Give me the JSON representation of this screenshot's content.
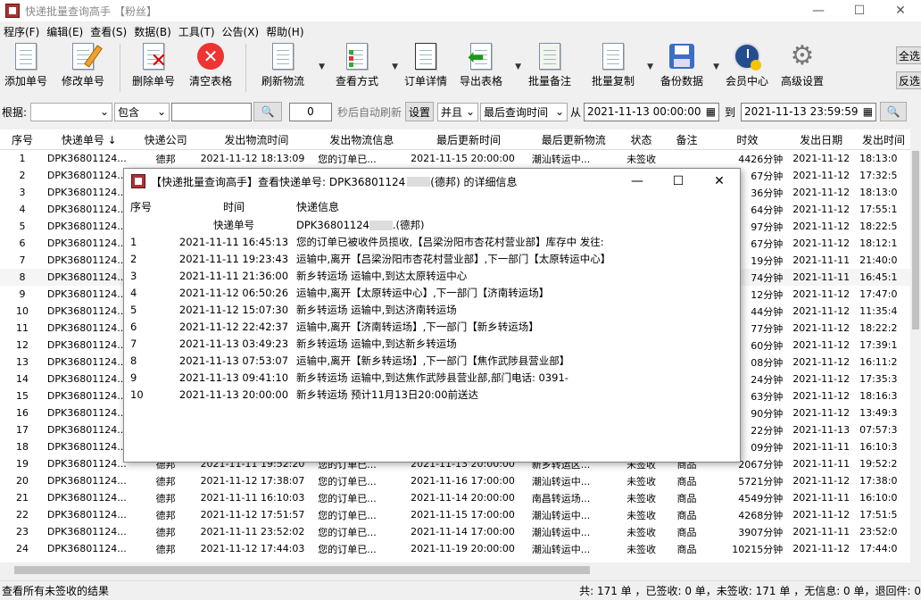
{
  "window": {
    "title": "快递批量查询高手",
    "title_suffix": "【粉丝】"
  },
  "menu": [
    "程序(F)",
    "编辑(E)",
    "查看(S)",
    "数据(B)",
    "工具(T)",
    "公告(X)",
    "帮助(H)"
  ],
  "toolbar": {
    "add": "添加单号",
    "edit": "修改单号",
    "delete": "删除单号",
    "clear": "清空表格",
    "refresh": "刷新物流",
    "view": "查看方式",
    "detail": "订单详情",
    "export": "导出表格",
    "note": "批量备注",
    "copy": "批量复制",
    "backup": "备份数据",
    "member": "会员中心",
    "advanced": "高级设置",
    "select_all": "全选",
    "invert": "反选"
  },
  "filter": {
    "label": "根据:",
    "field": "",
    "match": "包含",
    "keyword": "",
    "seconds": "0",
    "auto_refresh": "秒后自动刷新",
    "set": "设置",
    "and_or": "并且",
    "time_field": "最后查询时间",
    "from_label": "从",
    "from": "2021-11-13 00:00:00",
    "to_label": "到",
    "to": "2021-11-13 23:59:59"
  },
  "columns": [
    "序号",
    "快递单号 ↓",
    "快递公司",
    "发出物流时间",
    "发出物流信息",
    "最后更新时间",
    "最后更新物流",
    "状态",
    "备注",
    "时效",
    "发出日期",
    "发出时间"
  ],
  "rows": [
    [
      "1",
      "DPK36801124...",
      "德邦",
      "2021-11-12 18:13:09",
      "您的订单已...",
      "2021-11-15 20:00:00",
      "潮汕转运中...",
      "未签收",
      "",
      "4426分钟",
      "2021-11-12",
      "18:13:0"
    ],
    [
      "2",
      "DPK36801124...",
      "德邦",
      "",
      "",
      "",
      "",
      "",
      "",
      "67分钟",
      "2021-11-12",
      "17:32:5"
    ],
    [
      "3",
      "DPK36801124...",
      "德邦",
      "",
      "",
      "",
      "",
      "",
      "",
      "36分钟",
      "2021-11-12",
      "18:13:0"
    ],
    [
      "4",
      "DPK36801124...",
      "德邦",
      "",
      "",
      "",
      "",
      "",
      "",
      "64分钟",
      "2021-11-12",
      "17:55:1"
    ],
    [
      "5",
      "DPK36801124...",
      "德邦",
      "",
      "",
      "",
      "",
      "",
      "",
      "97分钟",
      "2021-11-12",
      "18:22:5"
    ],
    [
      "6",
      "DPK36801124...",
      "德邦",
      "",
      "",
      "",
      "",
      "",
      "",
      "67分钟",
      "2021-11-12",
      "18:12:1"
    ],
    [
      "7",
      "DPK36801124...",
      "德邦",
      "",
      "",
      "",
      "",
      "",
      "",
      "19分钟",
      "2021-11-11",
      "21:40:0"
    ],
    [
      "8",
      "DPK36801124...",
      "德邦",
      "",
      "",
      "",
      "",
      "",
      "",
      "74分钟",
      "2021-11-11",
      "16:45:1"
    ],
    [
      "9",
      "DPK36801124...",
      "德邦",
      "",
      "",
      "",
      "",
      "",
      "",
      "12分钟",
      "2021-11-12",
      "17:47:0"
    ],
    [
      "10",
      "DPK36801124...",
      "德邦",
      "",
      "",
      "",
      "",
      "",
      "",
      "44分钟",
      "2021-11-12",
      "11:35:4"
    ],
    [
      "11",
      "DPK36801124...",
      "德邦",
      "",
      "",
      "",
      "",
      "",
      "",
      "77分钟",
      "2021-11-12",
      "18:22:2"
    ],
    [
      "12",
      "DPK36801124...",
      "德邦",
      "",
      "",
      "",
      "",
      "",
      "",
      "60分钟",
      "2021-11-12",
      "17:39:1"
    ],
    [
      "13",
      "DPK36801124...",
      "德邦",
      "",
      "",
      "",
      "",
      "",
      "",
      "08分钟",
      "2021-11-12",
      "16:11:2"
    ],
    [
      "14",
      "DPK36801124...",
      "德邦",
      "",
      "",
      "",
      "",
      "",
      "",
      "24分钟",
      "2021-11-12",
      "17:35:3"
    ],
    [
      "15",
      "DPK36801124...",
      "德邦",
      "",
      "",
      "",
      "",
      "",
      "",
      "63分钟",
      "2021-11-12",
      "18:16:3"
    ],
    [
      "16",
      "DPK36801124...",
      "德邦",
      "",
      "",
      "",
      "",
      "",
      "",
      "90分钟",
      "2021-11-12",
      "13:49:3"
    ],
    [
      "17",
      "DPK36801124...",
      "德邦",
      "",
      "",
      "",
      "",
      "",
      "",
      "22分钟",
      "2021-11-13",
      "07:57:3"
    ],
    [
      "18",
      "DPK36801124...",
      "德邦",
      "",
      "",
      "",
      "",
      "",
      "",
      "09分钟",
      "2021-11-11",
      "16:10:3"
    ],
    [
      "19",
      "DPK36801124...",
      "德邦",
      "2021-11-11 19:52:20",
      "您的订单已...",
      "2021-11-13 20:00:00",
      "新乡转运区...",
      "未签收",
      "商品",
      "2067分钟",
      "2021-11-11",
      "19:52:2"
    ],
    [
      "20",
      "DPK36801124...",
      "德邦",
      "2021-11-12 17:38:07",
      "您的订单已...",
      "2021-11-16 17:00:00",
      "潮汕转运中...",
      "未签收",
      "商品",
      "5721分钟",
      "2021-11-12",
      "17:38:0"
    ],
    [
      "21",
      "DPK36801124...",
      "德邦",
      "2021-11-11 16:10:03",
      "您的订单已...",
      "2021-11-14 20:00:00",
      "南昌转运场...",
      "未签收",
      "商品",
      "4549分钟",
      "2021-11-11",
      "16:10:0"
    ],
    [
      "22",
      "DPK36801124...",
      "德邦",
      "2021-11-12 17:51:57",
      "您的订单已...",
      "2021-11-15 17:00:00",
      "潮汕转运中...",
      "未签收",
      "商品",
      "4268分钟",
      "2021-11-12",
      "17:51:5"
    ],
    [
      "23",
      "DPK36801124...",
      "德邦",
      "2021-11-11 23:52:02",
      "您的订单已...",
      "2021-11-14 17:00:00",
      "潮汕转运中...",
      "未签收",
      "商品",
      "3907分钟",
      "2021-11-11",
      "23:52:0"
    ],
    [
      "24",
      "DPK36801124...",
      "德邦",
      "2021-11-12 17:44:03",
      "您的订单已...",
      "2021-11-19 20:00:00",
      "潮汕转运中...",
      "未签收",
      "商品",
      "10215分钟",
      "2021-11-12",
      "17:44:0"
    ]
  ],
  "status": {
    "left": "查看所有未签收的结果",
    "right": "共: 171 单 ，已签收:  0 单，未签收:  171 单 ，无信息: 0 单，退回件: 0"
  },
  "dialog": {
    "title": "【快递批量查询高手】查看快递单号: DPK36801124",
    "title_tail": "(德邦) 的详细信息",
    "columns": [
      "序号",
      "时间",
      "快递信息"
    ],
    "subheader": {
      "label": "快递单号",
      "value": "DPK36801124",
      "tail": ".(德邦)"
    },
    "rows": [
      [
        "1",
        "2021-11-11 16:45:13",
        "您的订单已被收件员揽收,【吕梁汾阳市杏花村营业部】库存中 发往:"
      ],
      [
        "2",
        "2021-11-11 19:23:43",
        "运输中,离开【吕梁汾阳市杏花村营业部】,下一部门【太原转运中心】"
      ],
      [
        "3",
        "2021-11-11 21:36:00",
        "新乡转运场 运输中,到达太原转运中心"
      ],
      [
        "4",
        "2021-11-12 06:50:26",
        "运输中,离开【太原转运中心】,下一部门【济南转运场】"
      ],
      [
        "5",
        "2021-11-12 15:07:30",
        "新乡转运场 运输中,到达济南转运场"
      ],
      [
        "6",
        "2021-11-12 22:42:37",
        "运输中,离开【济南转运场】,下一部门【新乡转运场】"
      ],
      [
        "7",
        "2021-11-13 03:49:23",
        "新乡转运场 运输中,到达新乡转运场"
      ],
      [
        "8",
        "2021-11-13 07:53:07",
        "运输中,离开【新乡转运场】,下一部门【焦作武陟县营业部】"
      ],
      [
        "9",
        "2021-11-13 09:41:10",
        "新乡转运场 运输中,到达焦作武陟县营业部,部门电话: 0391-"
      ],
      [
        "10",
        "2021-11-13 20:00:00",
        "新乡转运场 预计11月13日20:00前送达"
      ]
    ]
  }
}
